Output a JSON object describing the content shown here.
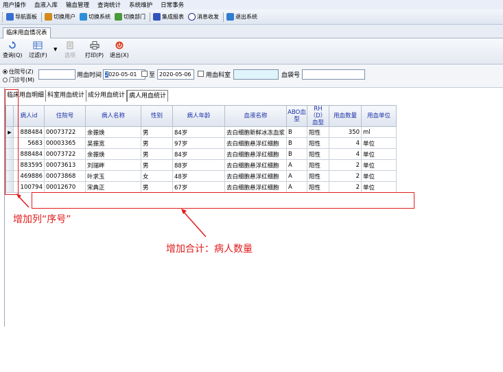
{
  "menu": {
    "items": [
      "用户操作",
      "血液入库",
      "输血管理",
      "查询统计",
      "系统维护",
      "日常事务"
    ]
  },
  "quickbar": {
    "items": [
      {
        "label": "导航面板",
        "icon": "navigation-panel-icon",
        "color": "#3a6fd1"
      },
      {
        "label": "切换用户",
        "icon": "switch-user-icon",
        "color": "#d48a1a"
      },
      {
        "label": "切换系统",
        "icon": "switch-system-icon",
        "color": "#2c8fd8"
      },
      {
        "label": "切换部门",
        "icon": "switch-department-icon",
        "color": "#4b9a3b"
      },
      {
        "label": "集成报表",
        "icon": "report-icon",
        "color": "#3355bb"
      },
      {
        "label": "消息收发",
        "icon": "message-icon",
        "color": "#2a2a88"
      },
      {
        "label": "退出系统",
        "icon": "exit-system-icon",
        "color": "#2f7dd0"
      }
    ]
  },
  "doc_tab": {
    "label": "临床用血情况表"
  },
  "toolbar": {
    "query": "查询(Q)",
    "filter": "过滤(F)",
    "options": "选项",
    "print": "打印(P)",
    "exit": "退出(X)"
  },
  "filters": {
    "radio_inpatient": "住院号(Z)",
    "radio_outpatient": "门诊号(M)",
    "blood_time_label": "用血时间",
    "date_from_selected": "2",
    "date_from_rest": "020-05-01",
    "to_label": "至",
    "date_to": "2020-05-06",
    "dept_label": "用血科室",
    "bag_label": "血袋号"
  },
  "subtabs": [
    "临床用血明细",
    "科室用血统计",
    "成分用血统计",
    "病人用血统计"
  ],
  "grid": {
    "headers": [
      "病人id",
      "住院号",
      "病人名称",
      "性别",
      "病人年龄",
      "血液名称",
      "ABO血型",
      "RH（D）血型",
      "用血数量",
      "用血单位"
    ],
    "rows": [
      {
        "id": "888484",
        "inpatient_no": "00073722",
        "name": "余振焕",
        "sex": "男",
        "age": "84岁",
        "blood": "去白细胞新鲜冰冻血浆",
        "abo": "B",
        "rh": "阳性",
        "qty": "350",
        "unit": "ml"
      },
      {
        "id": "5683",
        "inpatient_no": "00003365",
        "name": "吴振宽",
        "sex": "男",
        "age": "97岁",
        "blood": "去白细胞悬浮红细胞",
        "abo": "B",
        "rh": "阳性",
        "qty": "4",
        "unit": "单位"
      },
      {
        "id": "888484",
        "inpatient_no": "00073722",
        "name": "余振焕",
        "sex": "男",
        "age": "84岁",
        "blood": "去白细胞悬浮红细胞",
        "abo": "B",
        "rh": "阳性",
        "qty": "4",
        "unit": "单位"
      },
      {
        "id": "883595",
        "inpatient_no": "00073613",
        "name": "刘瑞畔",
        "sex": "男",
        "age": "88岁",
        "blood": "去白细胞悬浮红细胞",
        "abo": "A",
        "rh": "阳性",
        "qty": "2",
        "unit": "单位"
      },
      {
        "id": "469886",
        "inpatient_no": "00073868",
        "name": "叶求玉",
        "sex": "女",
        "age": "48岁",
        "blood": "去白细胞悬浮红细胞",
        "abo": "A",
        "rh": "阳性",
        "qty": "2",
        "unit": "单位"
      },
      {
        "id": "100794",
        "inpatient_no": "00012670",
        "name": "宋典正",
        "sex": "男",
        "age": "67岁",
        "blood": "去白细胞悬浮红细胞",
        "abo": "A",
        "rh": "阳性",
        "qty": "2",
        "unit": "单位"
      }
    ]
  },
  "annotations": {
    "add_serial_column": "增加列“序号”",
    "add_total": "增加合计：病人数量",
    "color": "#e11b1b"
  }
}
